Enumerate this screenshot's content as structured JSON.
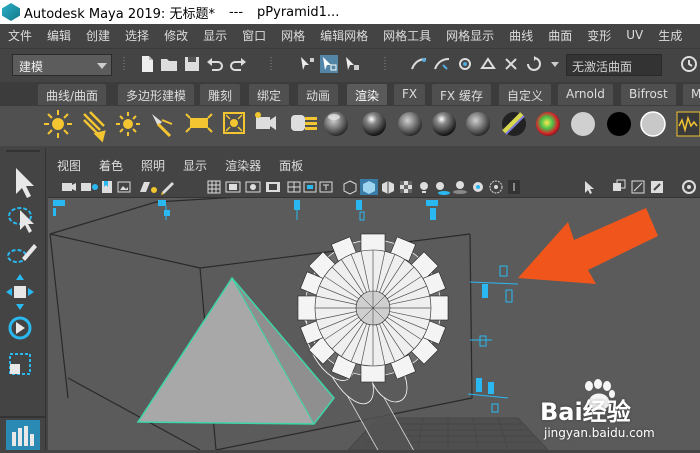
{
  "titlebar": {
    "app": "Autodesk Maya 2019: 无标题*",
    "sep": "---",
    "object": "pPyramid1..."
  },
  "menubar": {
    "items": [
      "文件",
      "编辑",
      "创建",
      "选择",
      "修改",
      "显示",
      "窗口",
      "网格",
      "编辑网格",
      "网格工具",
      "网格显示",
      "曲线",
      "曲面",
      "变形",
      "UV",
      "生成"
    ]
  },
  "toolbar": {
    "mode_label": "建模",
    "live_surface": "无激活曲面"
  },
  "shelf": {
    "tabs": [
      "曲线/曲面",
      "多边形建模",
      "雕刻",
      "绑定",
      "动画",
      "渲染",
      "FX",
      "FX 缓存",
      "自定义",
      "Arnold",
      "Bifrost",
      "M"
    ],
    "active_tab": "渲染"
  },
  "viewport_menu": {
    "items": [
      "视图",
      "着色",
      "照明",
      "显示",
      "渲染器",
      "面板"
    ]
  },
  "watermark": {
    "brand": "Bai经验",
    "url": "jingyan.baidu.com"
  },
  "colors": {
    "arrow": "#f0561c",
    "selection": "#3cd6a8",
    "handles": "#2ab8f0",
    "viewport_bg": "#5b5b5b"
  }
}
